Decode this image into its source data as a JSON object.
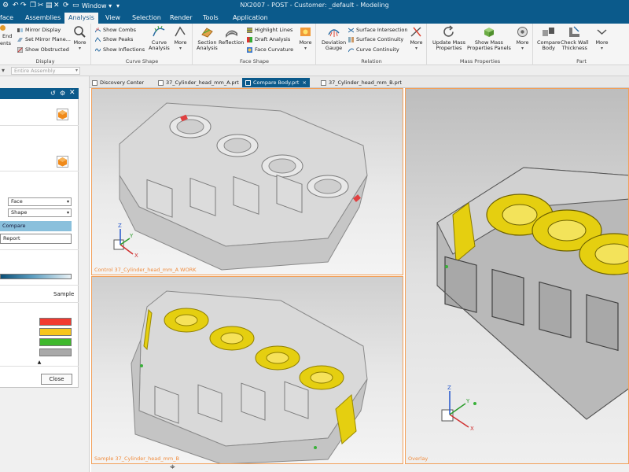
{
  "window": {
    "title": "NX2007 - POST - Customer: _default - Modeling",
    "window_menu_label": "Window"
  },
  "menubar": {
    "items": [
      {
        "label": "face"
      },
      {
        "label": "Assemblies"
      },
      {
        "label": "Analysis",
        "active": true
      },
      {
        "label": "View"
      },
      {
        "label": "Selection"
      },
      {
        "label": "Render"
      },
      {
        "label": "Tools"
      },
      {
        "label": "Application"
      }
    ]
  },
  "ribbon": {
    "display": {
      "title": "Display",
      "end_label": "End",
      "ents_label": "ents",
      "mirror_display": "Mirror Display",
      "set_mirror_plane": "Set Mirror Plane...",
      "show_obstructed": "Show Obstructed",
      "more": "More"
    },
    "curve_shape": {
      "title": "Curve Shape",
      "show_combs": "Show Combs",
      "show_peaks": "Show Peaks",
      "show_inflections": "Show Inflections",
      "curve_analysis_1": "Curve",
      "curve_analysis_2": "Analysis",
      "more": "More"
    },
    "face_shape": {
      "title": "Face Shape",
      "section_analysis_1": "Section",
      "section_analysis_2": "Analysis",
      "reflection": "Reflection",
      "highlight_lines": "Highlight Lines",
      "draft_analysis": "Draft Analysis",
      "face_curvature": "Face Curvature",
      "more": "More"
    },
    "relation": {
      "title": "Relation",
      "deviation_gauge_1": "Deviation",
      "deviation_gauge_2": "Gauge",
      "surface_intersection": "Surface Intersection",
      "surface_continuity": "Surface Continuity",
      "curve_continuity": "Curve Continuity",
      "more": "More"
    },
    "mass_properties": {
      "title": "Mass Properties",
      "update_mass_1": "Update Mass",
      "update_mass_2": "Properties",
      "show_mass_1": "Show Mass",
      "show_mass_2": "Properties Panels",
      "more": "More"
    },
    "part": {
      "title": "Part",
      "compare_body_1": "Compare",
      "compare_body_2": "Body",
      "check_wall_1": "Check Wall",
      "check_wall_2": "Thickness",
      "more": "More"
    }
  },
  "toolbar": {
    "selection_filter": "Entire Assembly"
  },
  "doc_tabs": [
    {
      "label": "Discovery Center",
      "active": false
    },
    {
      "label": "37_Cylinder_head_mm_A.prt",
      "active": false
    },
    {
      "label": "Compare Body.prt",
      "active": true
    },
    {
      "label": "37_Cylinder_head_mm_B.prt",
      "active": false
    }
  ],
  "dialog": {
    "field_1_value": "Face",
    "field_2_value": "Shape",
    "compare_button": "Compare",
    "report_button": "Report",
    "sample_label": "Sample",
    "close_button": "Close",
    "swatch_colors": [
      "#f23a30",
      "#f7c51d",
      "#3fb82c",
      "#a9a9a9"
    ]
  },
  "viewports": {
    "control_label": "Control 37_Cylinder_head_mm_A WORK",
    "sample_label": "Sample 37_Cylinder_head_mm_B",
    "overlay_label": "Overlay"
  },
  "triad": {
    "x": "X",
    "y": "Y",
    "z": "Z"
  },
  "colors": {
    "accent": "#0b5a8b",
    "viewport_border": "#f2a05a",
    "highlight_yellow": "#e5cf10"
  }
}
